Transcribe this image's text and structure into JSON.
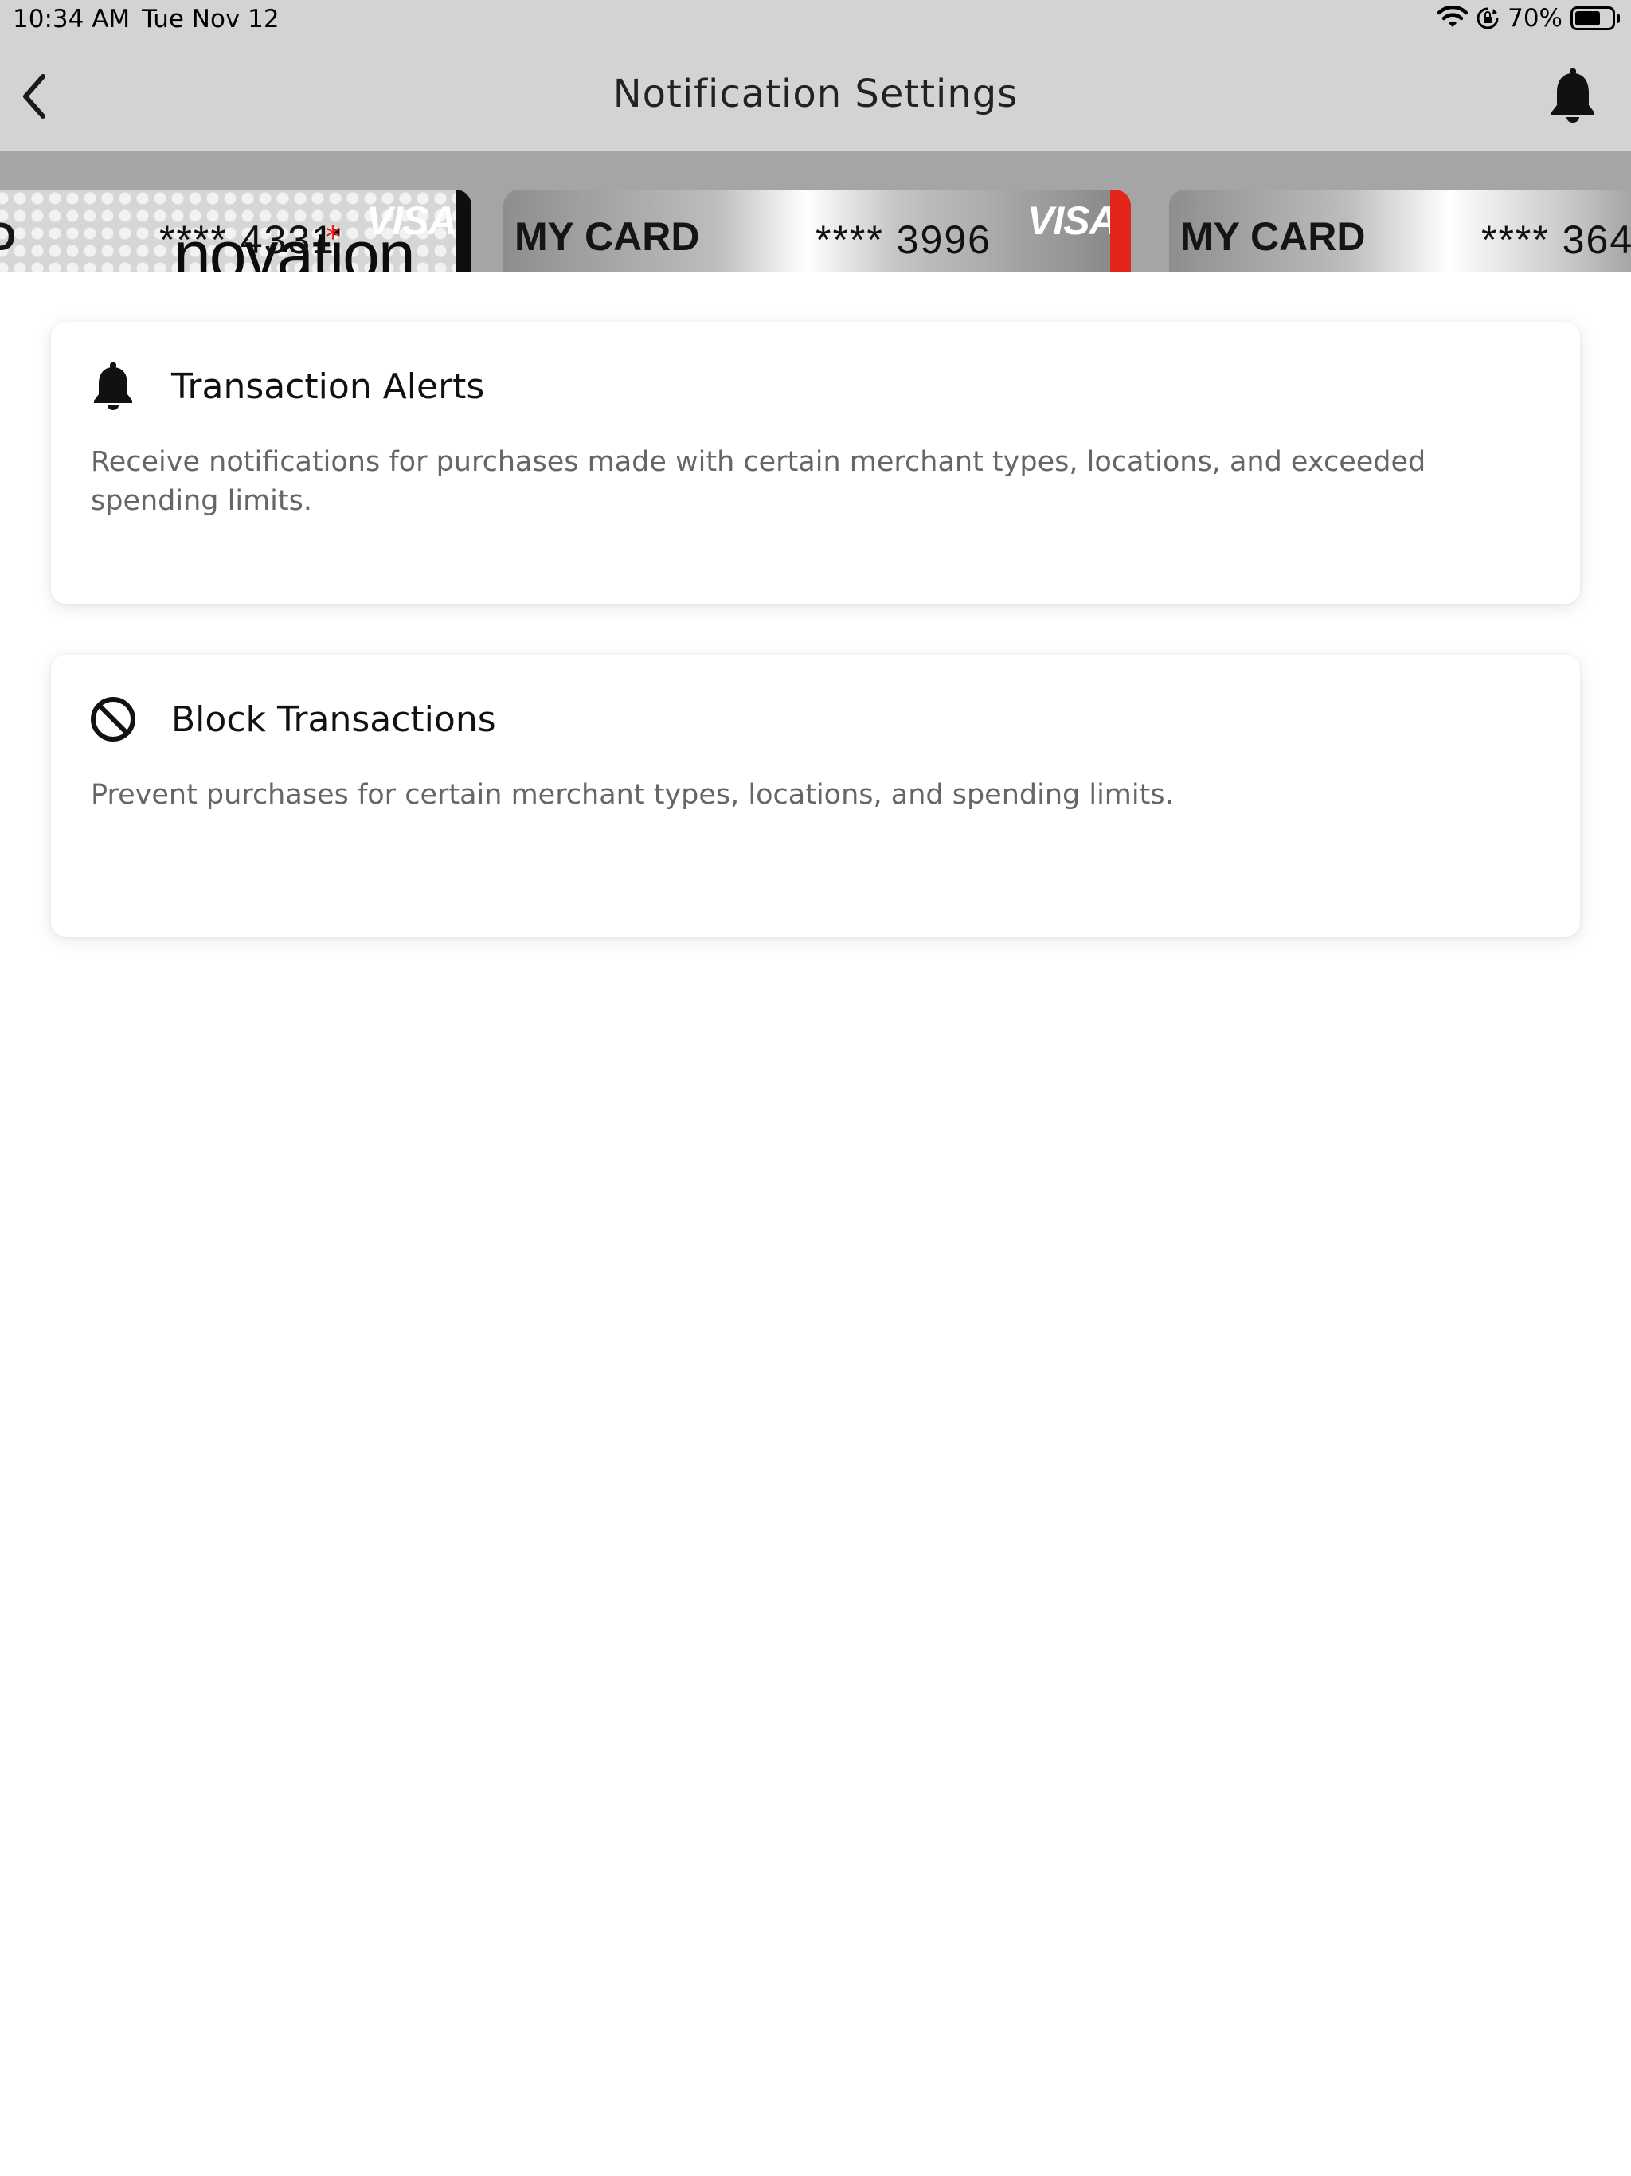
{
  "status_bar": {
    "time": "10:34 AM",
    "date": "Tue Nov 12",
    "battery": "70%",
    "battery_level": 0.7,
    "icons": [
      "wifi-icon",
      "lock-rotation-icon",
      "battery-icon"
    ]
  },
  "header": {
    "title": "Notification Settings",
    "back_icon": "chevron-left-icon",
    "action_icon": "bell-icon"
  },
  "cards": [
    {
      "label": "D",
      "number": "**** 4331",
      "network": "VISA",
      "brand": "novation"
    },
    {
      "label": "MY CARD",
      "number": "**** 3996",
      "network": "VISA"
    },
    {
      "label": "MY CARD",
      "number": "**** 364"
    }
  ],
  "options": [
    {
      "icon": "bell-icon",
      "title": "Transaction Alerts",
      "description": "Receive notifications for purchases made with certain merchant types, locations, and exceeded spending limits."
    },
    {
      "icon": "block-icon",
      "title": "Block Transactions",
      "description": "Prevent purchases for certain merchant types, locations, and spending limits."
    }
  ],
  "colors": {
    "header_bg": "#d3d3d3",
    "card_strip_bg": "#a5a5a5",
    "accent_red": "#e3261c",
    "description_text": "#666666"
  }
}
